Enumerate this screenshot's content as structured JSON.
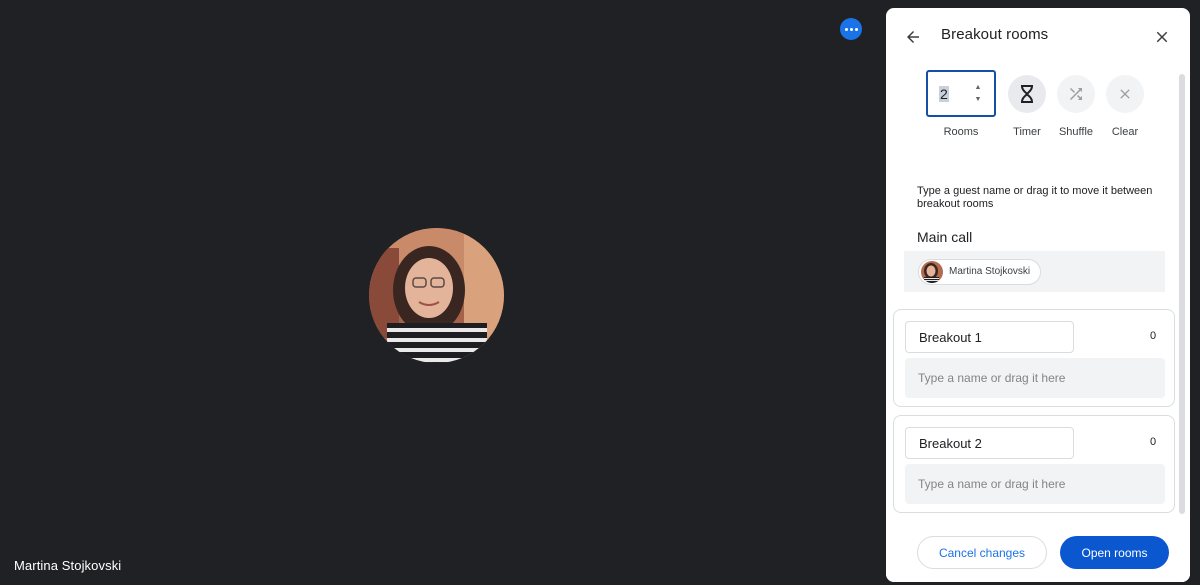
{
  "stage": {
    "participant_name": "Martina Stojkovski",
    "more_options_icon": "more-horiz-icon"
  },
  "panel": {
    "title": "Breakout rooms",
    "back_icon": "arrow-back-icon",
    "close_icon": "close-icon",
    "controls": {
      "rooms_value": "2",
      "rooms_label": "Rooms",
      "timer_label": "Timer",
      "shuffle_label": "Shuffle",
      "clear_label": "Clear"
    },
    "hint": "Type a guest name or drag it to move it between breakout rooms",
    "main_call": {
      "title": "Main call",
      "participants": [
        "Martina Stojkovski"
      ]
    },
    "rooms": [
      {
        "name": "Breakout 1",
        "count": "0",
        "placeholder": "Type a name or drag it here"
      },
      {
        "name": "Breakout 2",
        "count": "0",
        "placeholder": "Type a name or drag it here"
      }
    ],
    "footer": {
      "cancel_label": "Cancel changes",
      "open_label": "Open rooms"
    }
  },
  "colors": {
    "stage_bg": "#202124",
    "accent": "#1a73e8",
    "primary_button": "#0b57d0",
    "stepper_border": "#174ea6"
  }
}
